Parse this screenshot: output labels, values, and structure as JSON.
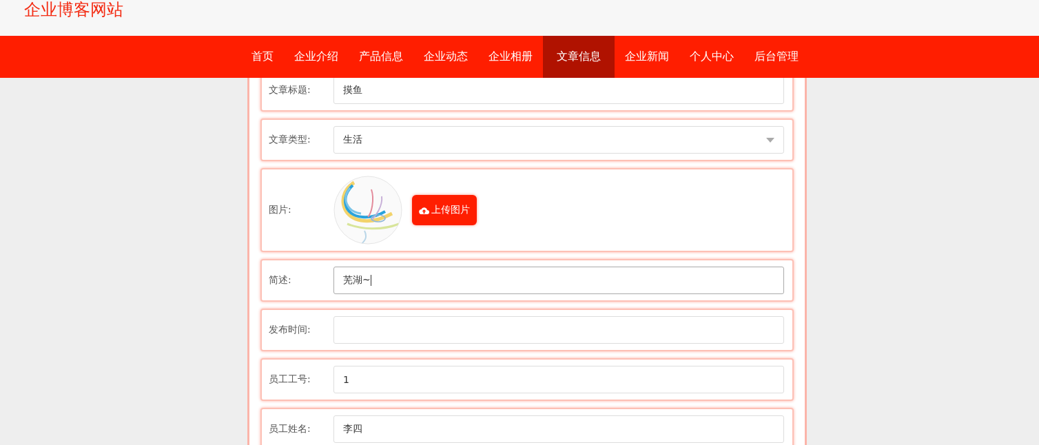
{
  "site_title": "企业博客网站",
  "nav": [
    {
      "label": "首页",
      "selected": false
    },
    {
      "label": "企业介绍",
      "selected": false
    },
    {
      "label": "产品信息",
      "selected": false
    },
    {
      "label": "企业动态",
      "selected": false
    },
    {
      "label": "企业相册",
      "selected": false
    },
    {
      "label": "文章信息",
      "selected": true
    },
    {
      "label": "企业新闻",
      "selected": false
    },
    {
      "label": "个人中心",
      "selected": false
    },
    {
      "label": "后台管理",
      "selected": false
    }
  ],
  "form": [
    {
      "kind": "text",
      "label": "文章标题:",
      "value": "摸鱼"
    },
    {
      "kind": "select",
      "label": "文章类型:",
      "value": "生活"
    },
    {
      "label": "图片:",
      "button": "上传图片"
    },
    {
      "kind": "text",
      "label": "简述:",
      "value": "芜湖~",
      "focused": true
    },
    {
      "kind": "text",
      "label": "发布时间:"
    },
    {
      "kind": "text",
      "label": "员工工号:",
      "value": "1"
    },
    {
      "kind": "text",
      "label": "员工姓名:",
      "value": "李四"
    }
  ]
}
